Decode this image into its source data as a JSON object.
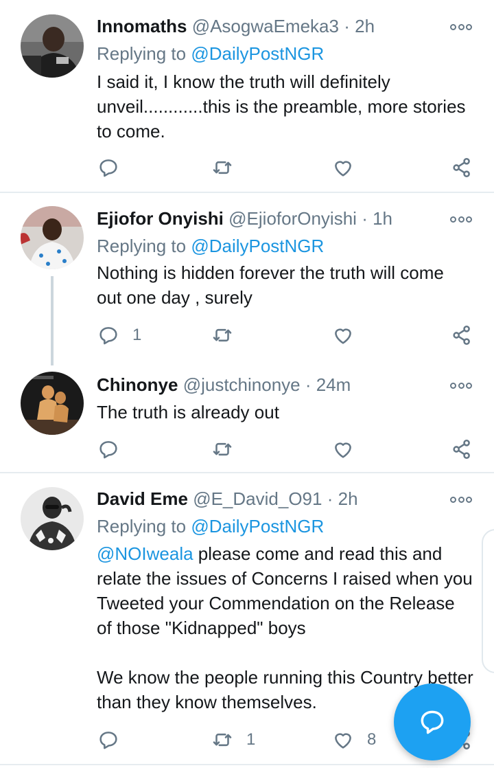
{
  "tweets": [
    {
      "name": "Innomaths",
      "handle": "@AsogwaEmeka3",
      "time": "2h",
      "replying_prefix": "Replying to",
      "replying_to": "@DailyPostNGR",
      "text": "I said it, I know the truth will definitely unveil............this is the preamble, more stories to come.",
      "reply_count": "",
      "retweet_count": "",
      "like_count": ""
    },
    {
      "name": "Ejiofor Onyishi",
      "handle": "@EjioforOnyishi",
      "time": "1h",
      "replying_prefix": "Replying to",
      "replying_to": "@DailyPostNGR",
      "text": "Nothing is hidden forever the truth will come out one day , surely",
      "reply_count": "1",
      "retweet_count": "",
      "like_count": ""
    },
    {
      "name": "Chinonye",
      "handle": "@justchinonye",
      "time": "24m",
      "text": "The truth is already out",
      "reply_count": "",
      "retweet_count": "",
      "like_count": ""
    },
    {
      "name": "David Eme",
      "handle": "@E_David_O91",
      "time": "2h",
      "replying_prefix": "Replying to",
      "replying_to": "@DailyPostNGR",
      "mention": "@NOIweala",
      "text": " please come and read this and relate the issues of Concerns I raised when you Tweeted your Commendation on the Release of those \"Kidnapped\" boys",
      "text2": "We know the people running this Country better than they know themselves.",
      "reply_count": "",
      "retweet_count": "1",
      "like_count": "8"
    }
  ],
  "separator": "·",
  "icons": {
    "reply": "reply-icon",
    "retweet": "retweet-icon",
    "like": "heart-icon",
    "share": "share-icon",
    "more": "more-options-icon",
    "compose": "compose-reply-icon"
  },
  "colors": {
    "accent": "#1da1f2",
    "link": "#1b95e0",
    "muted": "#657786",
    "text": "#14171a",
    "divider": "#e6ecf0"
  }
}
